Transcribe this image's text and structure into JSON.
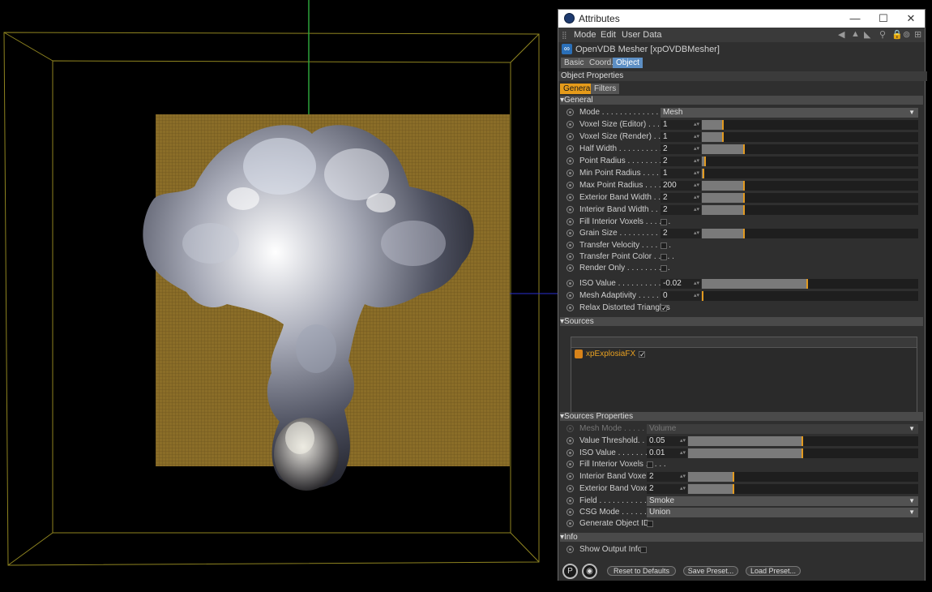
{
  "window": {
    "title": "Attributes",
    "minimize": "—",
    "maximize": "☐",
    "close": "✕"
  },
  "menu": {
    "mode": "Mode",
    "edit": "Edit",
    "user_data": "User Data"
  },
  "object": {
    "name": "OpenVDB Mesher [xpOVDBMesher]"
  },
  "tabs": {
    "basic": "Basic",
    "coord": "Coord.",
    "object": "Object"
  },
  "section_title": "Object Properties",
  "subtabs": {
    "general": "General",
    "filters": "Filters"
  },
  "general": {
    "group": "General",
    "mode_label": "Mode . . . . . . . . . . . . . .",
    "mode_value": "Mesh",
    "voxel_editor_label": "Voxel Size (Editor) . . . . . .",
    "voxel_editor_value": "1",
    "voxel_editor_level": 0.1,
    "voxel_render_label": "Voxel Size (Render) . . . . . .",
    "voxel_render_value": "1",
    "voxel_render_level": 0.1,
    "half_width_label": "Half Width . . . . . . . . . . .",
    "half_width_value": "2",
    "half_width_level": 0.2,
    "point_radius_label": "Point Radius . . . . . . . . . .",
    "point_radius_value": "2",
    "point_radius_level": 0.02,
    "min_point_label": "Min Point Radius . . . . . . . .",
    "min_point_value": "1",
    "min_point_level": 0.01,
    "max_point_label": "Max Point Radius . . . . . . .",
    "max_point_value": "200",
    "max_point_level": 0.2,
    "ext_band_label": "Exterior Band Width . . . . .",
    "ext_band_value": "2",
    "ext_band_level": 0.2,
    "int_band_label": "Interior Band Width . . . . .",
    "int_band_value": "2",
    "int_band_level": 0.2,
    "fill_interior_label": "Fill Interior Voxels . . . . . .",
    "grain_label": "Grain Size . . . . . . . . . . .",
    "grain_value": "2",
    "grain_level": 0.2,
    "transfer_velocity_label": "Transfer Velocity . . . . . . .",
    "transfer_color_label": "Transfer Point Color . . . . .",
    "render_only_label": "Render Only . . . . . . . . . .",
    "iso_label": "ISO Value . . . . . . . . . . . .",
    "iso_value": "-0.02",
    "iso_level": 0.49,
    "adaptivity_label": "Mesh Adaptivity . . . . . . . .",
    "adaptivity_value": "0",
    "adaptivity_level": 0.0,
    "relax_label": "Relax Distorted Triangles",
    "relax_check": "✓"
  },
  "sources": {
    "group": "Sources",
    "item_name": "xpExplosiaFX",
    "item_check": "✓"
  },
  "sources_props": {
    "group": "Sources Properties",
    "mesh_mode_label": "Mesh Mode . . . . . . . . . .",
    "mesh_mode_value": "Volume",
    "value_threshold_label": "Value Threshold. . . . .",
    "value_threshold_value": "0.05",
    "value_threshold_level": 0.5,
    "iso_label": "ISO Value . . . . . . . . . .",
    "iso_value": "0.01",
    "iso_level": 0.5,
    "fill_interior_label": "Fill Interior Voxels . . . . .",
    "int_band_label": "Interior Band Voxels",
    "int_band_value": "2",
    "int_band_level": 0.2,
    "ext_band_label": "Exterior Band Voxels",
    "ext_band_value": "2",
    "ext_band_level": 0.2,
    "field_label": "Field . . . . . . . . . . . . . .",
    "field_value": "Smoke",
    "csg_label": "CSG Mode . . . . . . . . . .",
    "csg_value": "Union",
    "gen_id_label": "Generate Object ID"
  },
  "info": {
    "group": "Info",
    "show_output_label": "Show Output Info"
  },
  "footer": {
    "reset": "Reset to Defaults",
    "save": "Save Preset...",
    "load": "Load Preset..."
  }
}
